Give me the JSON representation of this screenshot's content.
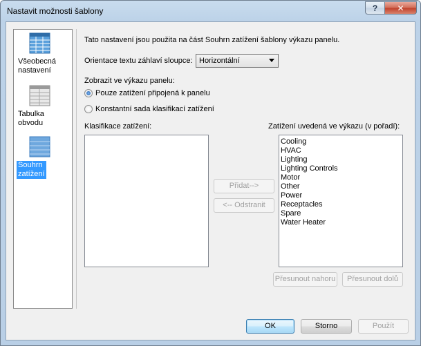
{
  "window": {
    "title": "Nastavit možnosti šablony"
  },
  "titlebar": {
    "help_glyph": "?",
    "close_glyph": "✕"
  },
  "sidebar": {
    "items": [
      {
        "label_line1": "Všeobecná",
        "label_line2": "nastavení",
        "icon": "general-settings-icon",
        "selected": false
      },
      {
        "label_line1": "Tabulka",
        "label_line2": "obvodu",
        "icon": "circuit-table-icon",
        "selected": false
      },
      {
        "label_line1": "Souhrn",
        "label_line2": "zatížení",
        "icon": "load-summary-icon",
        "selected": true
      }
    ]
  },
  "panel": {
    "description": "Tato nastavení jsou použita na část Souhrn zatížení šablony výkazu panelu.",
    "orientation_label": "Orientace textu záhlaví sloupce:",
    "orientation_value": "Horizontální",
    "display_label": "Zobrazit ve výkazu panelu:",
    "radio_options": [
      {
        "label": "Pouze zatížení připojená k panelu",
        "checked": true
      },
      {
        "label": "Konstantní sada klasifikací zatížení",
        "checked": false
      }
    ],
    "classifications_label": "Klasifikace zatížení:",
    "classifications": [],
    "add_button": "Přidat-->",
    "remove_button": "<-- Odstranit",
    "scheduled_label": "Zatížení uvedená ve výkazu (v pořadí):",
    "scheduled_loads": [
      "Cooling",
      "HVAC",
      "Lighting",
      "Lighting Controls",
      "Motor",
      "Other",
      "Power",
      "Receptacles",
      "Spare",
      "Water Heater"
    ],
    "move_up_button": "Přesunout nahoru",
    "move_down_button": "Přesunout dolů"
  },
  "footer": {
    "ok": "OK",
    "cancel": "Storno",
    "apply": "Použít"
  },
  "colors": {
    "selection": "#3399ff",
    "icon_blue": "#4f93d1",
    "icon_gray": "#9a9a9a"
  }
}
